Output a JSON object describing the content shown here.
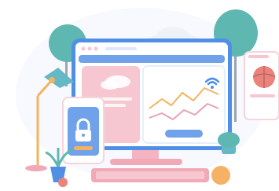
{
  "scene": {
    "palette": {
      "monitor_frame": "#4f8fe6",
      "screen_bg": "#f2f6ff",
      "pink_panel": "#f6c7d1",
      "lock_card": "#6fa2ea",
      "teal_tree": "#5fb7b2",
      "basketball": "#e9837b",
      "orange_ball": "#f6b264",
      "keyboard": "#f1a9b8",
      "lamp": "#64b9c4"
    },
    "icons": [
      "lock-icon",
      "wifi-icon",
      "basketball-icon",
      "desk-lamp-icon",
      "potted-plant-icon",
      "cloud-icon",
      "tree-icon"
    ],
    "screen_chart": {
      "type": "line",
      "series_count": 2
    }
  }
}
